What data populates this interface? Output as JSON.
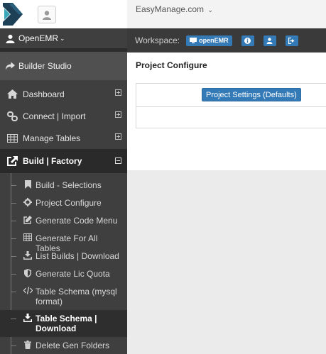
{
  "topbar": {
    "site_title": "EasyManage.com",
    "caret": "⌄"
  },
  "user": {
    "name": "OpenEMR",
    "caret": "⌄"
  },
  "builder": {
    "label": "Builder Studio"
  },
  "nav": [
    {
      "label": "Dashboard",
      "icon": "home-icon"
    },
    {
      "label": "Connect | Import",
      "icon": "link-icon"
    },
    {
      "label": "Manage Tables",
      "icon": "table-icon"
    },
    {
      "label": "Build | Factory",
      "icon": "external-link-icon"
    }
  ],
  "subnav": [
    {
      "label": "Build - Selections",
      "icon": "bookmark-icon"
    },
    {
      "label": "Project Configure",
      "icon": "cog-icon"
    },
    {
      "label": "Generate Code Menu",
      "icon": "edit-icon"
    },
    {
      "label": "Generate For All Tables",
      "icon": "grid-icon"
    },
    {
      "label": "List Builds | Download",
      "icon": "download-icon"
    },
    {
      "label": "Generate Lic Quota",
      "icon": "shield-icon"
    },
    {
      "label": "Table Schema (mysql format)",
      "icon": "code-icon"
    },
    {
      "label": "Table Schema | Download",
      "icon": "download-icon"
    },
    {
      "label": "Delete Gen Folders",
      "icon": "trash-icon"
    }
  ],
  "workspace": {
    "label": "Workspace:",
    "name": "openEMR"
  },
  "page": {
    "title": "Project Configure",
    "settings_button": "Project Settings (Defaults)"
  },
  "colors": {
    "accent": "#337ab7",
    "sidebar": "#3f3f3f",
    "workspace_bar": "#3a3a3a",
    "logo_dark": "#1d4057",
    "logo_teal": "#3aa6b9"
  }
}
